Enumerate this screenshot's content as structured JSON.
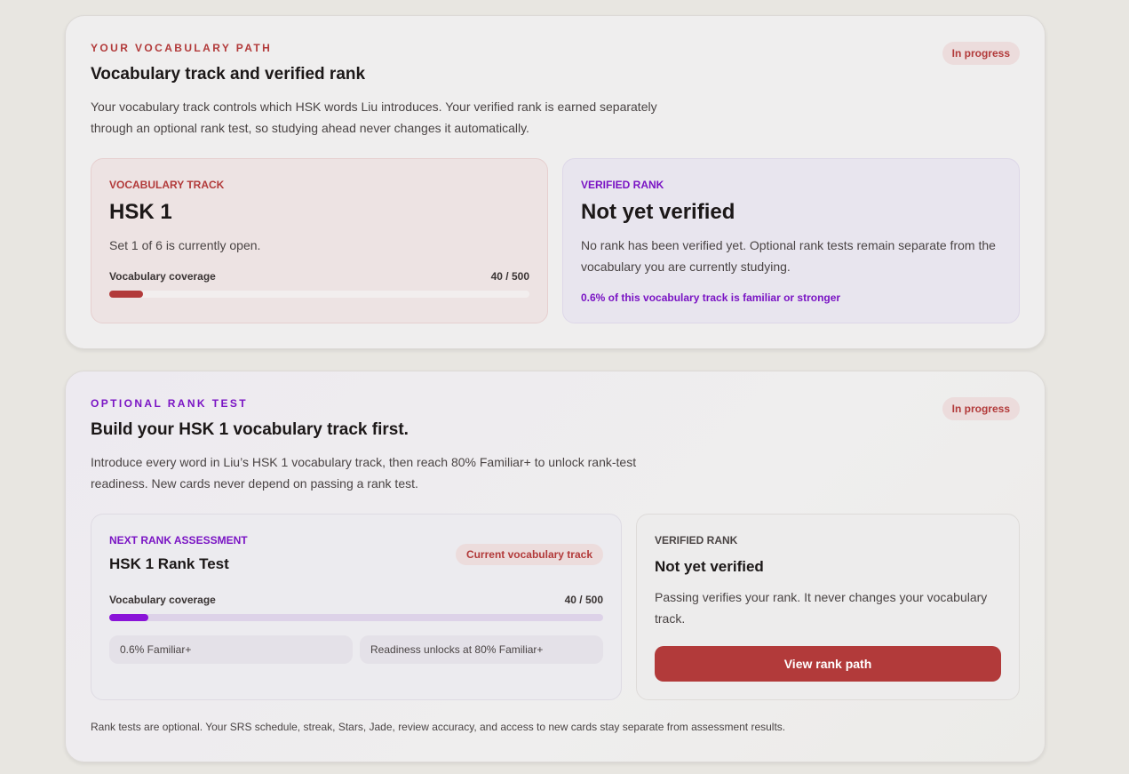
{
  "path_panel": {
    "eyebrow": "YOUR VOCABULARY PATH",
    "title": "Vocabulary track and verified rank",
    "description": "Your vocabulary track controls which HSK words Liu introduces. Your verified rank is earned separately through an optional rank test, so studying ahead never changes it automatically.",
    "badge": "In progress",
    "track_card": {
      "label": "VOCABULARY TRACK",
      "title": "HSK 1",
      "text": "Set 1 of 6 is currently open.",
      "coverage_label": "Vocabulary coverage",
      "coverage_count": "40 / 500",
      "coverage_fraction": 0.08
    },
    "verified_card": {
      "label": "VERIFIED RANK",
      "title": "Not yet verified",
      "text": "No rank has been verified yet. Optional rank tests remain separate from the vocabulary you are currently studying.",
      "note": "0.6% of this vocabulary track is familiar or stronger"
    }
  },
  "rank_panel": {
    "eyebrow": "OPTIONAL RANK TEST",
    "title": "Build your HSK 1 vocabulary track first.",
    "description": "Introduce every word in Liu’s HSK 1 vocabulary track, then reach 80% Familiar+ to unlock rank-test readiness. New cards never depend on passing a rank test.",
    "badge": "In progress",
    "next_card": {
      "label": "NEXT RANK ASSESSMENT",
      "title": "HSK 1 Rank Test",
      "badge": "Current vocabulary track",
      "coverage_label": "Vocabulary coverage",
      "coverage_count": "40 / 500",
      "coverage_fraction": 0.08,
      "chip_familiar": "0.6% Familiar+",
      "chip_readiness": "Readiness unlocks at 80% Familiar+"
    },
    "verified_card": {
      "label": "VERIFIED RANK",
      "title": "Not yet verified",
      "text": "Passing verifies your rank. It never changes your vocabulary track.",
      "button": "View rank path"
    },
    "footnote": "Rank tests are optional. Your SRS schedule, streak, Stars, Jade, review accuracy, and access to new cards stay separate from assessment results."
  },
  "colors": {
    "accent_red": "#b23a3a",
    "accent_purple": "#7a14c4",
    "bar_purple": "#8a14d8"
  }
}
